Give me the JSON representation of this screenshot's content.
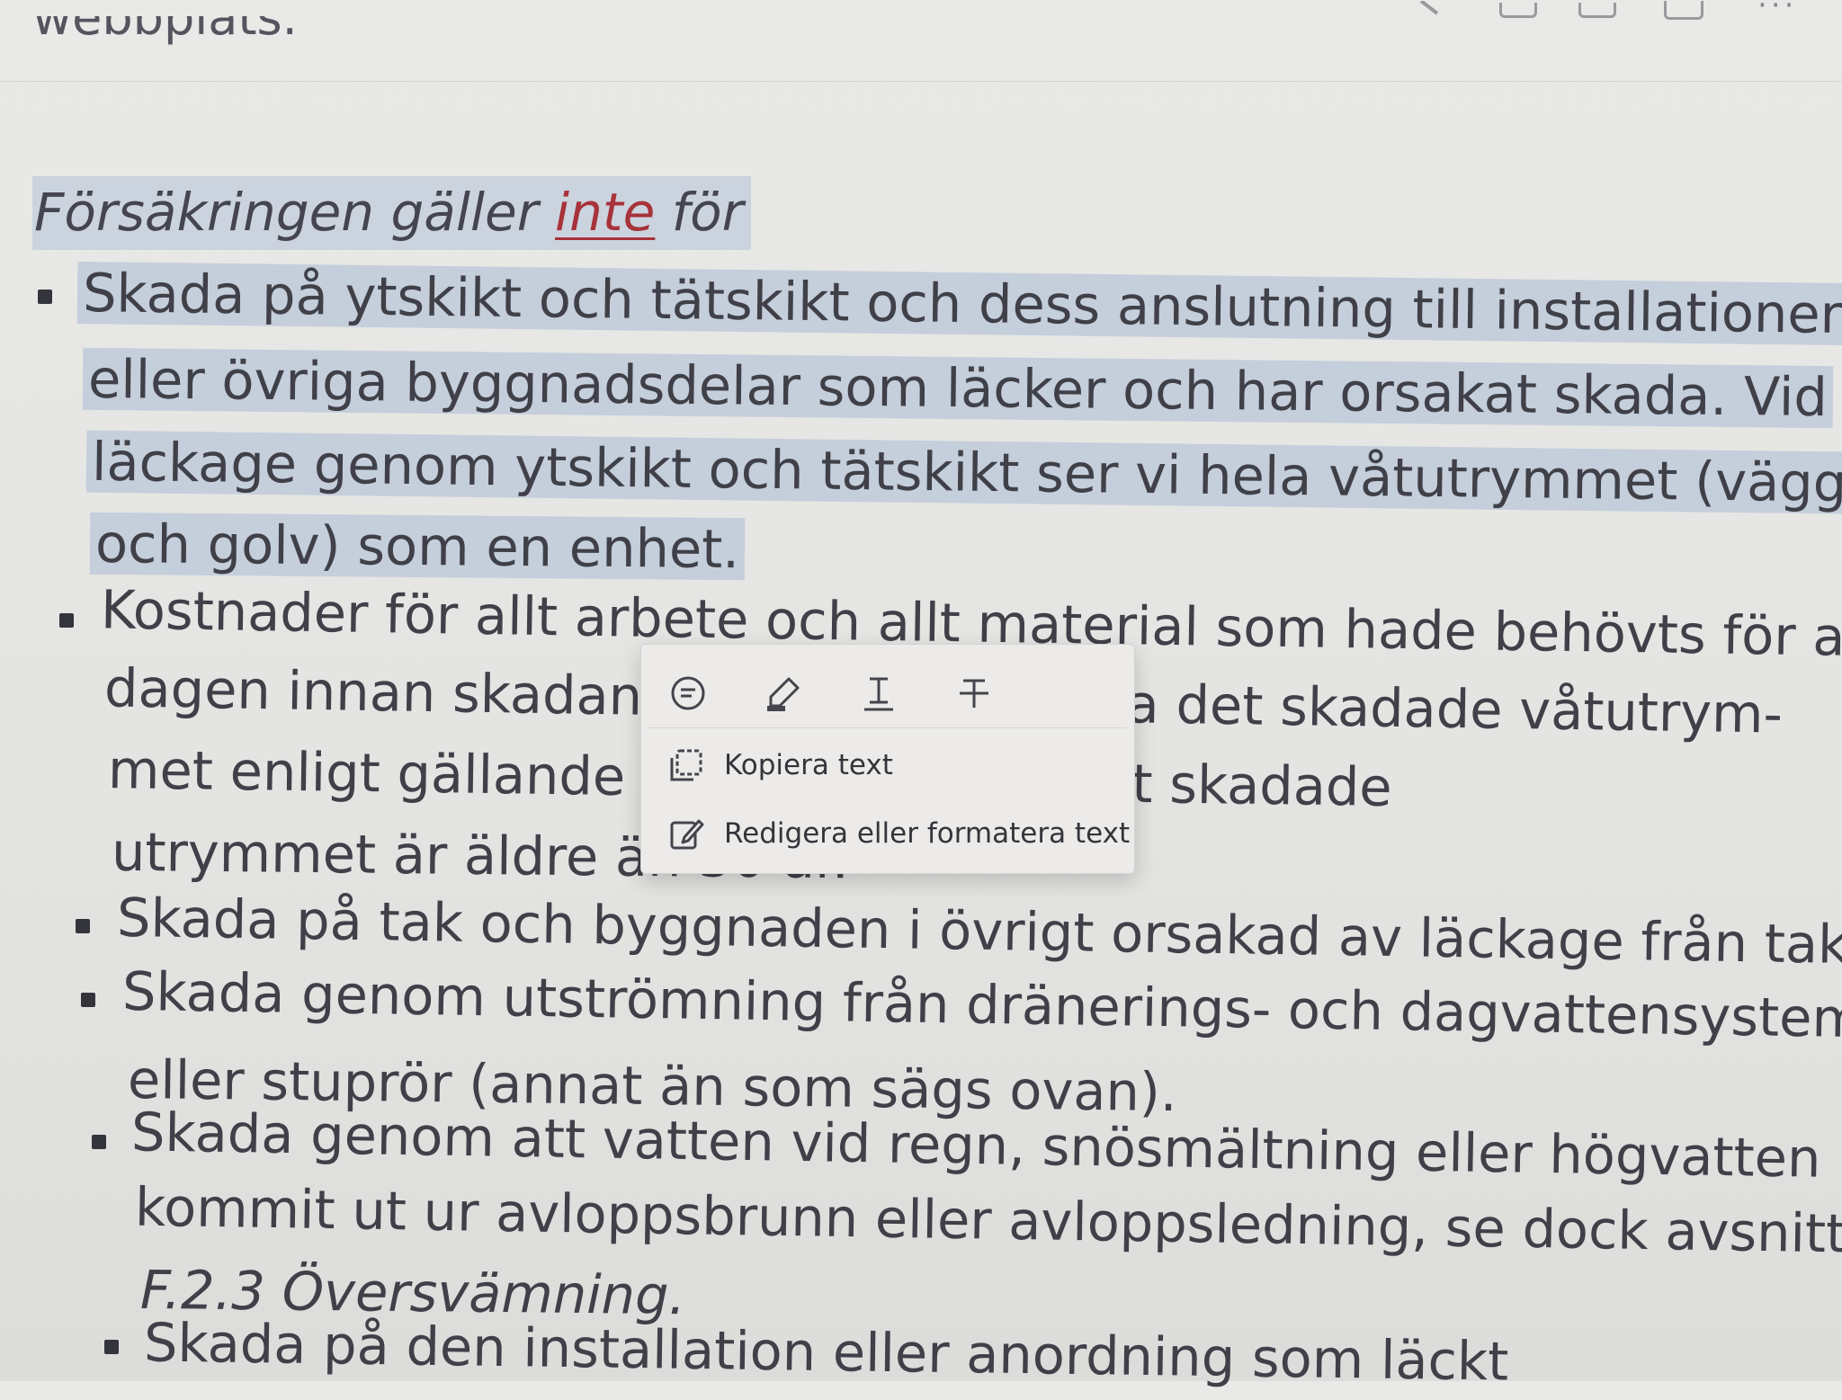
{
  "top_cut_text": "webbplats.",
  "heading": {
    "part1": "Försäkringen gäller",
    "emphasis": "inte",
    "part2": "för"
  },
  "lines": {
    "b1_l1": "Skada på ytskikt och tätskikt och dess anslutning till installationer",
    "b1_l2": "eller övriga byggnadsdelar som läcker och har orsakat skada. Vid",
    "b1_l3": "läckage genom ytskikt och tätskikt ser vi hela våtutrymmet (väggar",
    "b1_l4": "och golv) som en enhet.",
    "b2_l1": "Kostnader för allt arbete och allt material som hade behövts för att,",
    "b2_l2": "dagen innan skadan uppstod, återställa det skadade våtutrym-",
    "b2_l3": "met enligt gällande byggregler, om det skadade",
    "b2_l4": "utrymmet är äldre än 30 år.",
    "b3_l1": "Skada på tak och byggnaden i övrigt orsakad av läckage från tak.",
    "b4_l1": "Skada genom utströmning från dränerings- och dagvattensystem",
    "b4_l2": "eller stuprör (annat än som sägs ovan).",
    "b5_l1": "Skada genom att vatten vid regn, snösmältning eller högvatten",
    "b5_l2": "kommit ut ur avloppsbrunn eller avloppsledning, se dock avsnittet",
    "b5_l3": "F.2.3 Översvämning.",
    "b6_l1": "Skada på den installation eller anordning som läckt"
  },
  "popup": {
    "tools": [
      "comment-icon",
      "highlight-pen-icon",
      "underline-icon",
      "strikethrough-icon"
    ],
    "copy_label": "Kopiera text",
    "edit_label": "Redigera eller formatera text"
  },
  "colors": {
    "selection": "#c5cedb",
    "emphasis": "#a7323a",
    "text": "#3f4048"
  }
}
